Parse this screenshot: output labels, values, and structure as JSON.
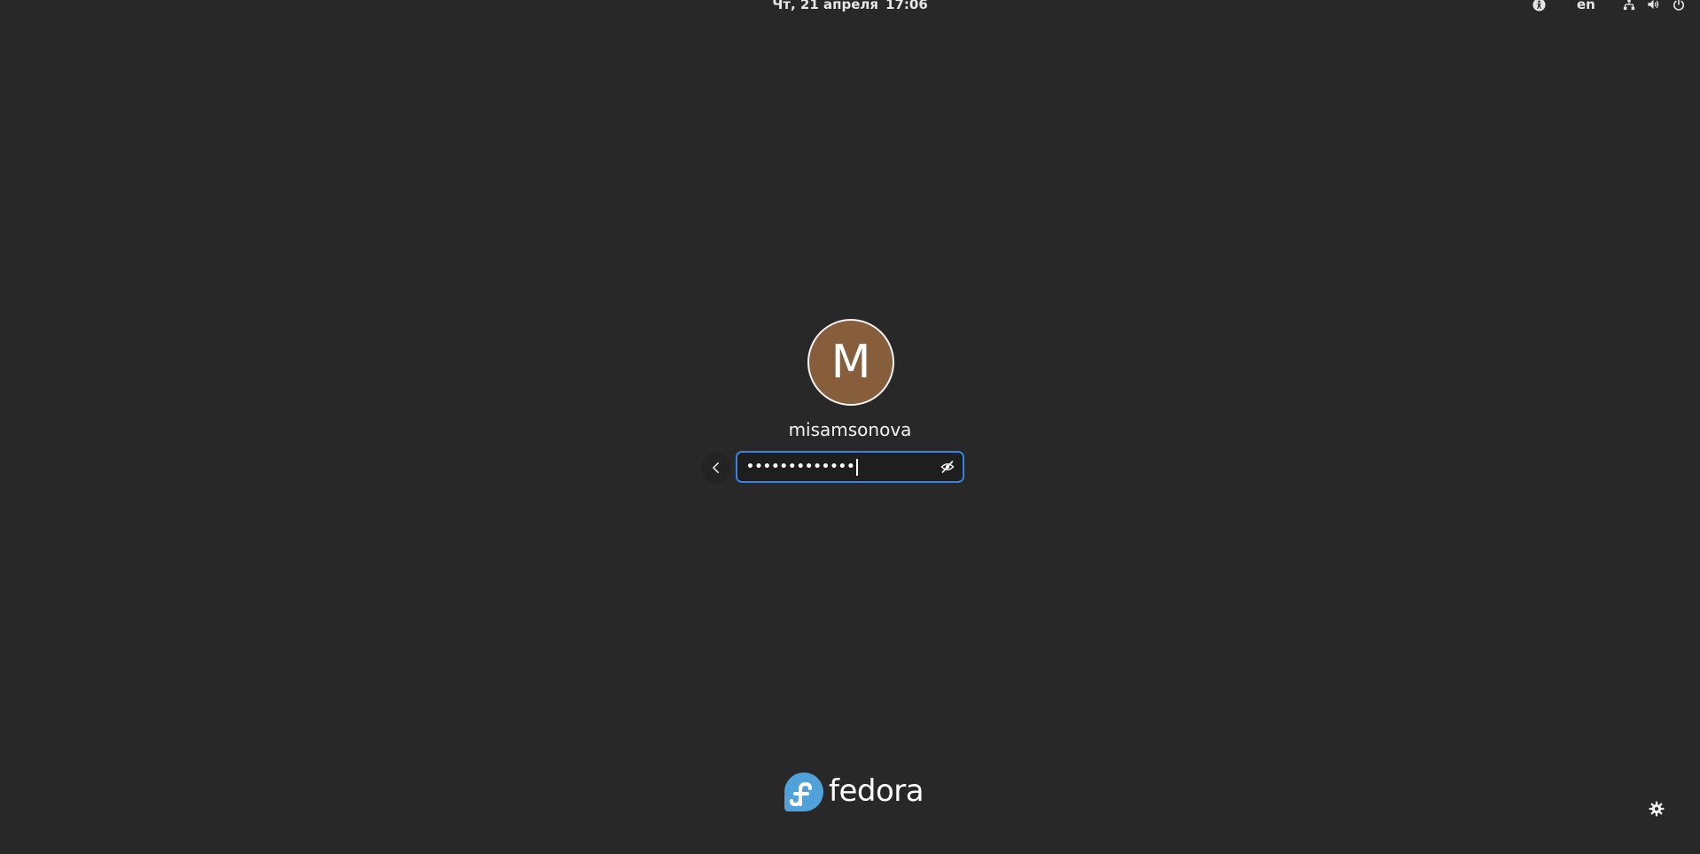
{
  "top_bar": {
    "date": "Чт, 21 апреля",
    "time": "17:06",
    "language": "en",
    "icons": [
      "accessibility-icon",
      "network-icon",
      "volume-icon",
      "power-icon"
    ]
  },
  "login": {
    "avatar_initial": "M",
    "avatar_color": "#865e3c",
    "username": "misamsonova",
    "password_masked": "•••••••••••••",
    "focus_color": "#3584e4"
  },
  "branding": {
    "logo_text": "fedora"
  },
  "footer": {
    "settings_icon": "gear-icon"
  }
}
